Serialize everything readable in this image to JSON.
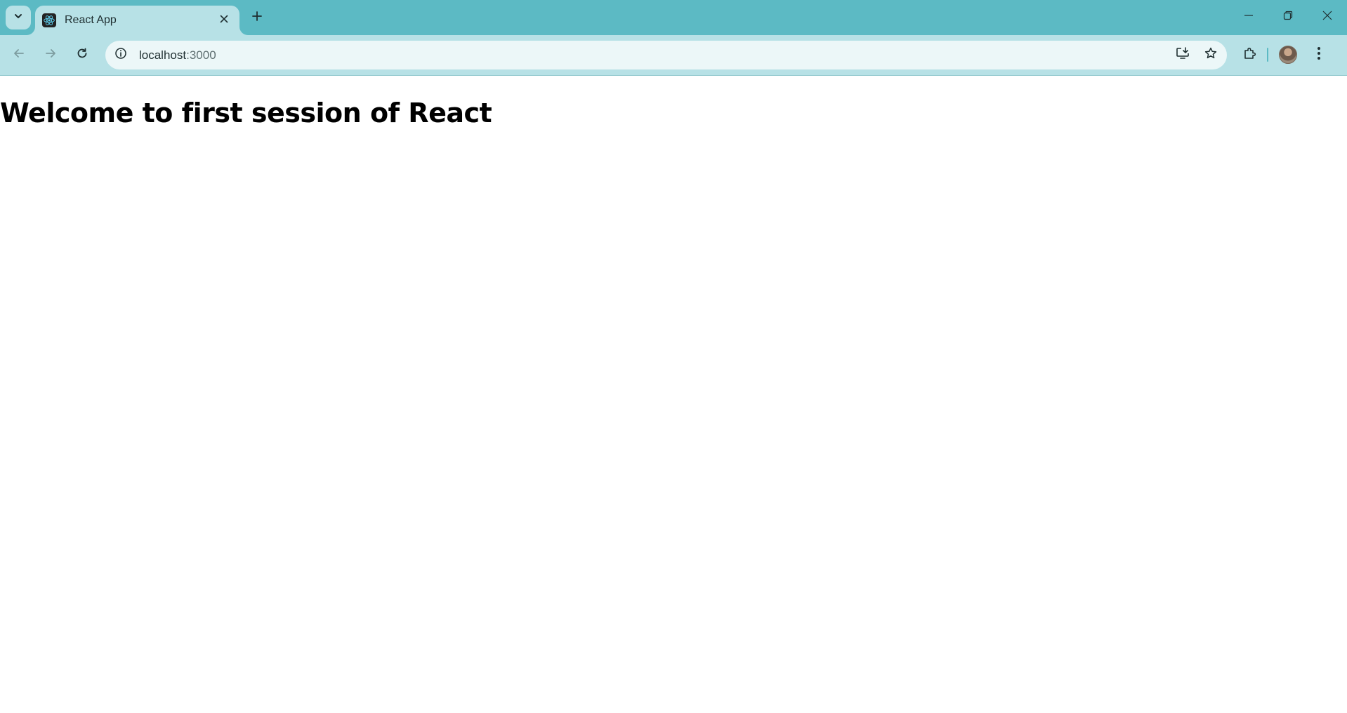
{
  "browser": {
    "tab": {
      "title": "React App",
      "favicon": "react-logo-icon"
    },
    "address_bar": {
      "host": "localhost",
      "port": ":3000"
    },
    "colors": {
      "frame": "#5cbac4",
      "toolbar": "#b7e1e6",
      "omnibox": "#ecf7f8",
      "react_accent": "#61dafb"
    }
  },
  "page": {
    "heading": "Welcome to first session of React"
  }
}
